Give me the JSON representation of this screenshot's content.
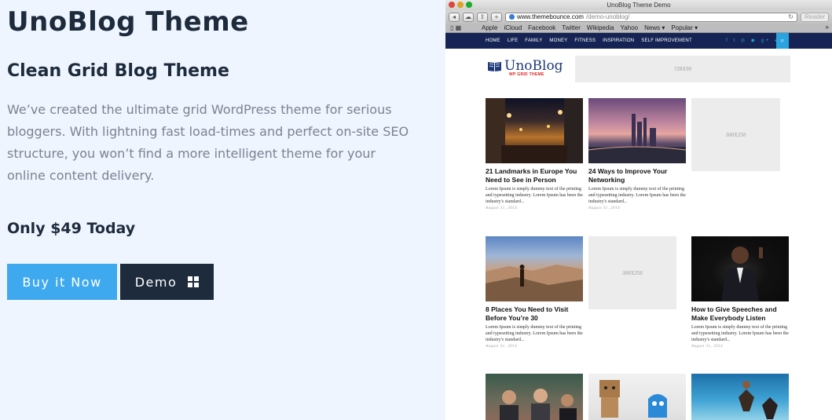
{
  "promo": {
    "title": "UnoBlog Theme",
    "subtitle": "Clean Grid Blog Theme",
    "description": "We’ve created the ultimate grid WordPress theme for serious bloggers. With lightning fast load-times and perfect on-site SEO structure, you won’t find a more intelligent theme for your online content delivery.",
    "price": "Only $49 Today",
    "buy_label": "Buy it Now",
    "demo_label": "Demo"
  },
  "browser": {
    "window_title": "UnoBlog Theme Demo",
    "url_domain": "www.themebounce.com",
    "url_path": "/demo-unoblog/",
    "reader_label": "Reader",
    "add_tab_label": "+",
    "bookmarks": [
      "Apple",
      "iCloud",
      "Facebook",
      "Twitter",
      "Wikipedia",
      "Yahoo",
      "News ▾",
      "Popular ▾"
    ]
  },
  "site": {
    "nav": [
      "HOME",
      "LIFE",
      "FAMILY",
      "MONEY",
      "FITNESS",
      "INSPIRATION",
      "SELF IMPROVEMENT"
    ],
    "social_icons": "f t ◎ ◉ g+ ◈ ◙",
    "logo_text": "UnoBlog",
    "logo_tagline": "WP GRID THEME",
    "header_ad": "728X90",
    "sidebar_ad_1": "300X250",
    "sidebar_ad_2": "300X250",
    "posts": [
      {
        "title": "21 Landmarks in Europe You Need to See in Person",
        "excerpt": "Lorem Ipsum is simply dummy text of the printing and typesetting industry. Lorem Ipsum has been the industry's standard...",
        "date": "August 31, 2014"
      },
      {
        "title": "24 Ways to Improve Your Networking",
        "excerpt": "Lorem Ipsum is simply dummy text of the printing and typesetting industry. Lorem Ipsum has been the industry's standard...",
        "date": "August 31, 2014"
      },
      {
        "title": "8 Places You Need to Visit Before You’re 30",
        "excerpt": "Lorem Ipsum is simply dummy text of the printing and typesetting industry. Lorem Ipsum has been the industry's standard...",
        "date": "August 31, 2014"
      },
      {
        "title": "How to Give Speeches and Make Everybody Listen",
        "excerpt": "Lorem Ipsum is simply dummy text of the printing and typesetting industry. Lorem Ipsum has been the industry's standard...",
        "date": "August 31, 2014"
      }
    ]
  },
  "colors": {
    "accent_blue": "#3fa9f0",
    "navy": "#1d2b3c",
    "site_nav": "#152454",
    "page_bg": "#eef5ff"
  }
}
